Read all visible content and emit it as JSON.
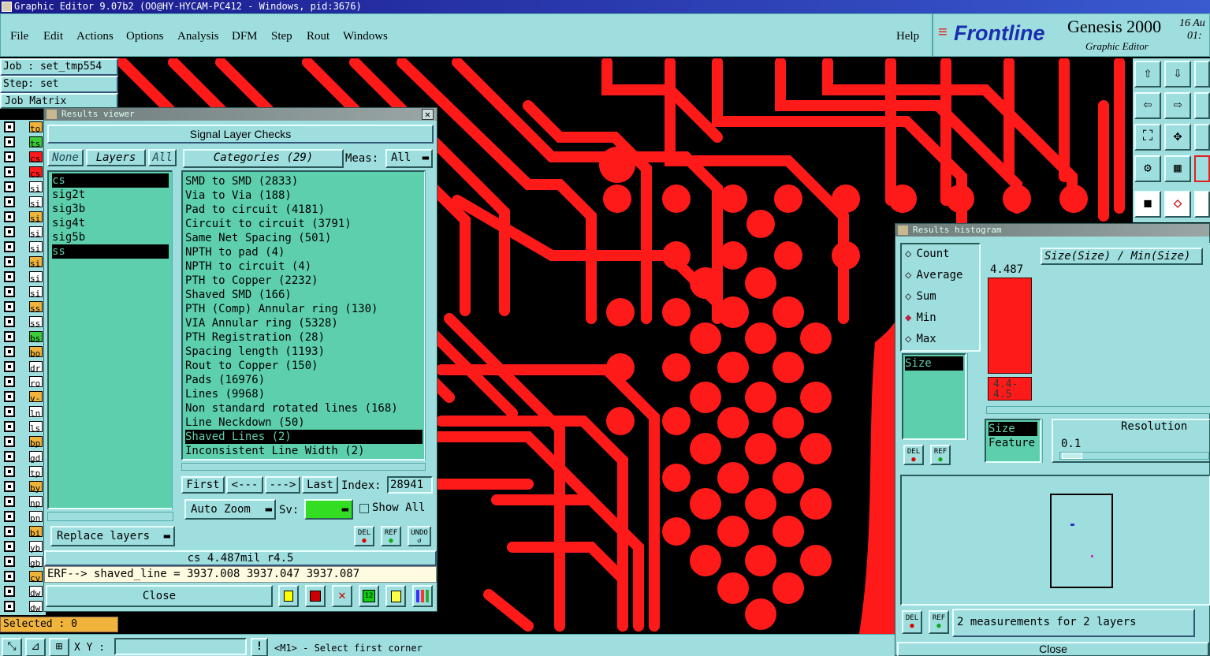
{
  "title_bar": "Graphic Editor 9.07b2 (OO@HY-HYCAM-PC412 - Windows, pid:3676)",
  "menu": [
    "File",
    "Edit",
    "Actions",
    "Options",
    "Analysis",
    "DFM",
    "Step",
    "Rout",
    "Windows"
  ],
  "help": "Help",
  "brand": {
    "logo": "Frontline",
    "product": "Genesis 2000",
    "subtitle": "Graphic Editor",
    "date": "16 Au",
    "time": "01:"
  },
  "job": {
    "job_label": "Job : set_tmp554",
    "step_label": "Step: set",
    "matrix_button": "Job Matrix"
  },
  "layers_left": [
    "to",
    "ts",
    "cs",
    "cs",
    "si",
    "si",
    "si",
    "si",
    "si",
    "si",
    "si",
    "si",
    "ss",
    "ss",
    "bs",
    "bo",
    "dr",
    "ro",
    "v-",
    "ln",
    "ls",
    "bp",
    "gd",
    "tp",
    "by",
    "np",
    "pn",
    "bi",
    "yb",
    "gb",
    "cv",
    "dw",
    "dw"
  ],
  "selected_status": "Selected : 0",
  "bottom_bar": {
    "xy_label": "X Y :",
    "hint": "<M1> - Select first corner"
  },
  "results_viewer": {
    "title": "Results viewer",
    "header": "Signal Layer Checks",
    "none_button": "None",
    "layers_button": "Layers",
    "all_button": "All",
    "layers": [
      "cs",
      "sig2t",
      "sig3b",
      "sig4t",
      "sig5b",
      "ss"
    ],
    "categories_label": "Categories (29)",
    "meas_label": "Meas:",
    "meas_value": "All",
    "categories": [
      "SMD to SMD (2833)",
      "Via to Via (188)",
      "Pad to circuit (4181)",
      "Circuit to circuit (3791)",
      "Same Net Spacing (501)",
      "NPTH to pad (4)",
      "NPTH to circuit (4)",
      "PTH to Copper (2232)",
      "Shaved SMD (166)",
      "PTH (Comp) Annular ring (130)",
      "VIA Annular ring (5328)",
      "PTH Registration (28)",
      "Spacing length (1193)",
      "Rout to Copper (150)",
      "Pads (16976)",
      "Lines (9968)",
      "Non standard rotated lines (168)",
      "Line Neckdown (50)",
      "Shaved Lines (2)",
      "Inconsistent Line Width (2)"
    ],
    "selected_category": 18,
    "nav": {
      "first": "First",
      "prev": "<---",
      "next": "--->",
      "last": "Last",
      "index_label": "Index:",
      "index_value": "28941"
    },
    "auto_zoom": "Auto Zoom",
    "sv_label": "Sv:",
    "show_all": "Show All",
    "replace_layers": "Replace layers",
    "status_line": "cs 4.487mil  r4.5",
    "erf_line": "ERF--> shaved_line = 3937.008 3937.047 3937.087",
    "close": "Close",
    "small_buttons": [
      "DEL",
      "REF",
      "UNDO"
    ]
  },
  "histogram": {
    "title": "Results histogram",
    "options": [
      "Count",
      "Average",
      "Sum",
      "Min",
      "Max"
    ],
    "selected_option": "Min",
    "size_list": [
      "Size"
    ],
    "header": "Size(Size) / Min(Size)",
    "bar_value": "4.487",
    "bar_fraction": 1.0,
    "bar_range_label": "4.4-\n4.5",
    "attr_list": [
      "Size",
      "Feature"
    ],
    "resolution_label": "Resolution",
    "resolution_value": "0.1",
    "status": "2 measurements for 2 layers",
    "close": "Close",
    "small_buttons": [
      "DEL",
      "REF"
    ]
  },
  "colors": {
    "copper": "#ff1a1a",
    "panel": "#5dcfad",
    "frame": "#9fdede",
    "sv_green": "#33dd22"
  }
}
